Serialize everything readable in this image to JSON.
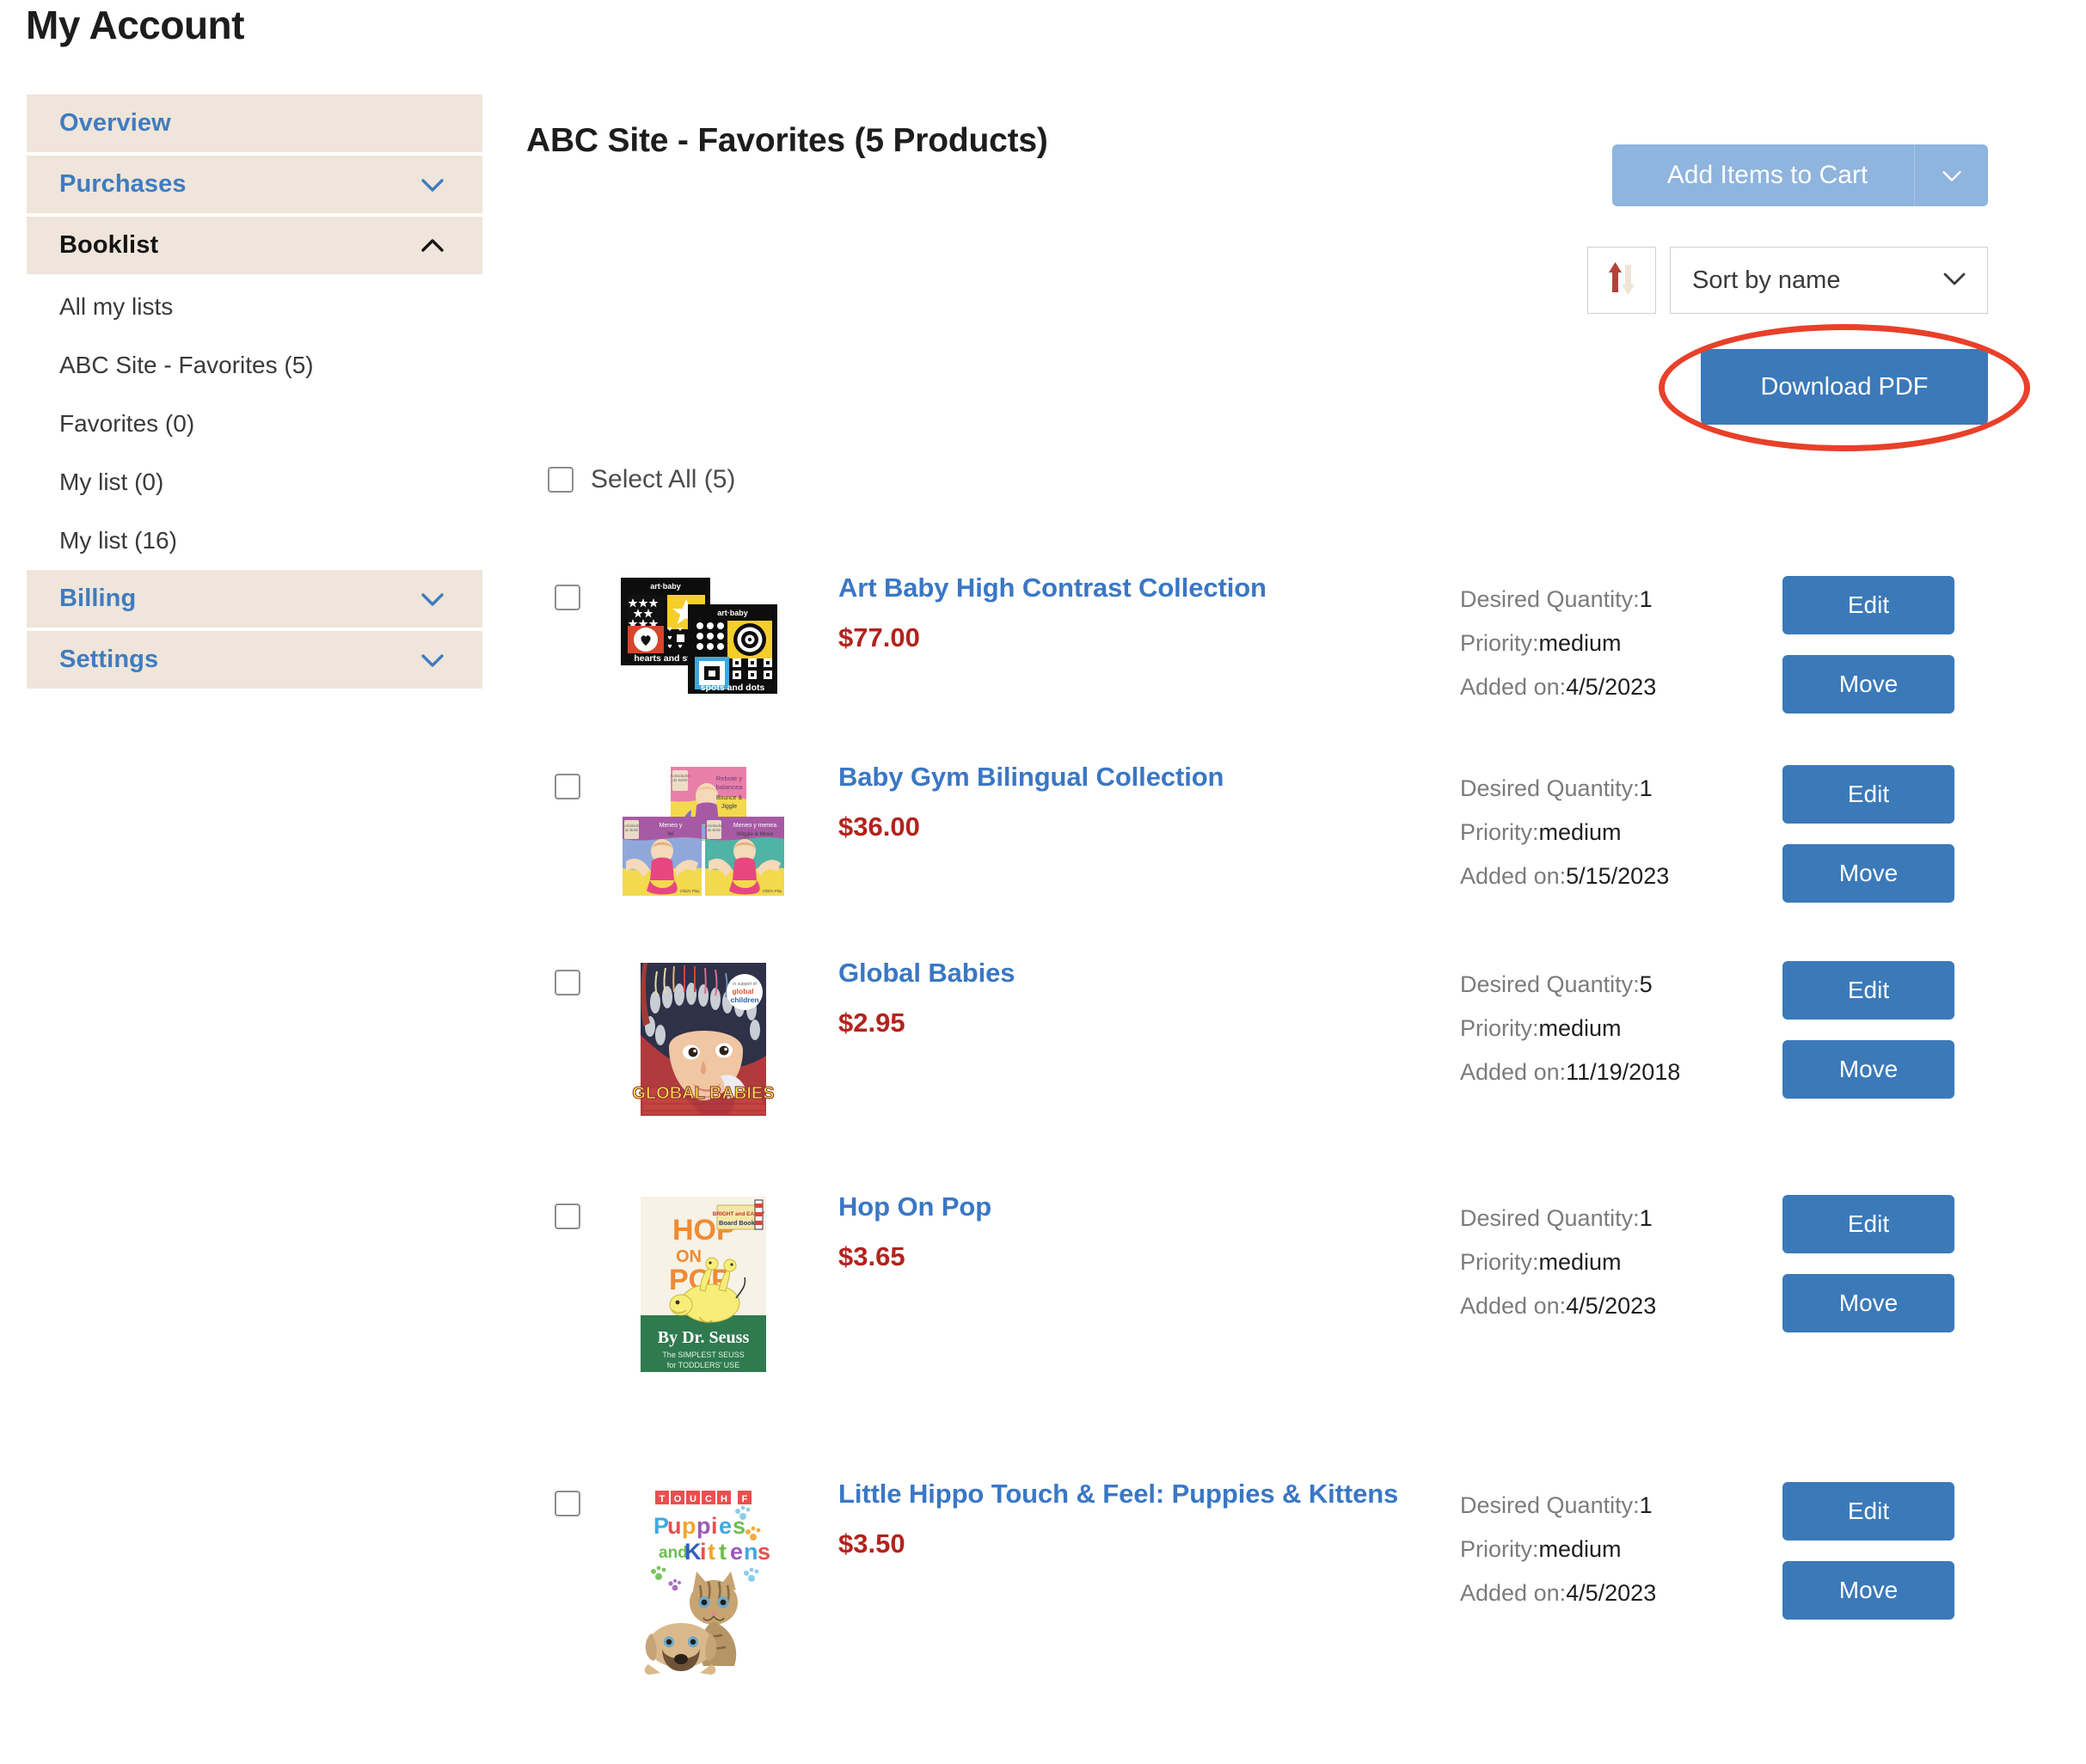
{
  "page": {
    "title": "My Account"
  },
  "sidebar": {
    "items": [
      {
        "label": "Overview",
        "type": "band",
        "expandable": false,
        "active": false
      },
      {
        "label": "Purchases",
        "type": "band",
        "expandable": true,
        "expanded": false,
        "active": false
      },
      {
        "label": "Booklist",
        "type": "band",
        "expandable": true,
        "expanded": true,
        "active": true
      },
      {
        "label": "All my lists",
        "type": "sub"
      },
      {
        "label": "ABC Site - Favorites (5)",
        "type": "sub"
      },
      {
        "label": "Favorites (0)",
        "type": "sub"
      },
      {
        "label": "My list (0)",
        "type": "sub"
      },
      {
        "label": "My list (16)",
        "type": "sub"
      },
      {
        "label": "Billing",
        "type": "band",
        "expandable": true,
        "expanded": false,
        "active": false
      },
      {
        "label": "Settings",
        "type": "band",
        "expandable": true,
        "expanded": false,
        "active": false
      }
    ]
  },
  "main": {
    "list_title": "ABC Site - Favorites (5 Products)",
    "select_all_label": "Select All (5)",
    "toolbar": {
      "add_to_cart_label": "Add Items to Cart",
      "sort_value": "Sort by name",
      "download_pdf_label": "Download PDF",
      "sort_direction_icon": "sort-ascending-icon"
    },
    "meta_labels": {
      "quantity": "Desired Quantity:",
      "priority": "Priority:",
      "added": "Added on:"
    },
    "action_labels": {
      "edit": "Edit",
      "move": "Move"
    },
    "products": [
      {
        "title": "Art Baby High Contrast Collection",
        "price": "$77.00",
        "quantity": "1",
        "priority": "medium",
        "added_on": "4/5/2023",
        "cover_text_1": "art·baby",
        "cover_text_2": "hearts and st",
        "cover_text_3": "art·baby",
        "cover_text_4": "spots and dots"
      },
      {
        "title": "Baby Gym Bilingual Collection",
        "price": "$36.00",
        "quantity": "1",
        "priority": "medium",
        "added_on": "5/15/2023",
        "cover_text_1": "Rebote y balancea",
        "cover_text_2": "Bounce & Jiggle",
        "cover_text_3": "Meneo y menea",
        "cover_text_4": "Wiggle & Move"
      },
      {
        "title": "Global Babies",
        "price": "$2.95",
        "quantity": "5",
        "priority": "medium",
        "added_on": "11/19/2018",
        "cover_text_1": "GLOBAL BABIES",
        "cover_text_2": "in support of",
        "cover_text_3": "global",
        "cover_text_4": "children"
      },
      {
        "title": "Hop On Pop",
        "price": "$3.65",
        "quantity": "1",
        "priority": "medium",
        "added_on": "4/5/2023",
        "cover_text_1": "HOP ON POP",
        "cover_text_2": "By Dr. Seuss",
        "cover_text_3": "The SIMPLEST SEUSS",
        "cover_text_4": "for TODDLERS' USE"
      },
      {
        "title": "Little Hippo Touch & Feel: Puppies & Kittens",
        "price": "$3.50",
        "quantity": "1",
        "priority": "medium",
        "added_on": "4/5/2023",
        "cover_text_1": "TOUCH & FEEL",
        "cover_text_2": "Puppies",
        "cover_text_3": "and",
        "cover_text_4": "Kittens"
      }
    ]
  },
  "colors": {
    "sidebar_band": "#EFE5DA",
    "link_blue": "#3F7CC0",
    "primary_button": "#3B79B9",
    "muted_button": "#8FB4DD",
    "price_red": "#B3231D",
    "annotation_red": "#E8402A",
    "sort_arrow_up": "#B5413A",
    "sort_arrow_down": "#EFE4D6"
  }
}
